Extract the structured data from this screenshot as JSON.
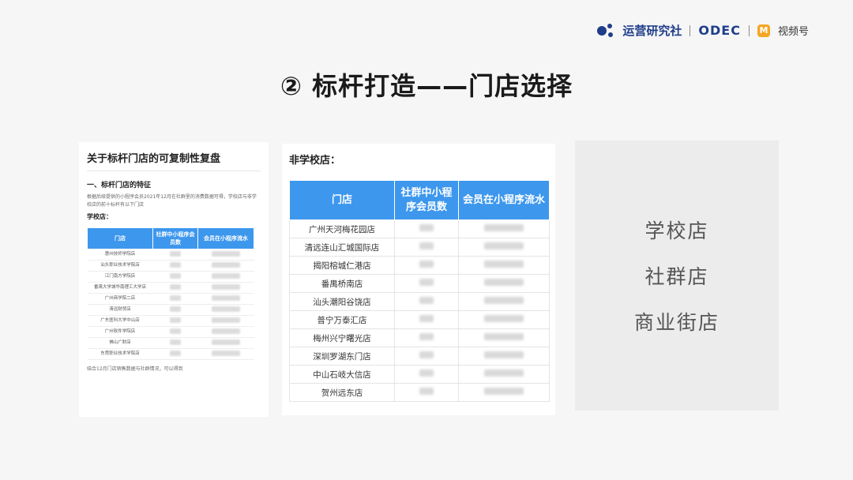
{
  "brand": {
    "name": "运营研究社",
    "odec": "ODEC",
    "video_icon": "M",
    "video": "视频号"
  },
  "title": "② 标杆打造——门店选择",
  "doc": {
    "title": "关于标杆门店的可复制性复盘",
    "section": "一、标杆门店的特征",
    "paragraph": "根据后续提供的小程序会员2021年12月在社群里的消费数据可得，学校店与非学校店的前十标杆有以下门店",
    "subtitle": "学校店：",
    "headers": [
      "门店",
      "社群中小程序会员数",
      "会员在小程序流水"
    ],
    "rows": [
      "惠州技师学院店",
      "汕头职业技术学院店",
      "江门南方学院店",
      "番禺大学城华南理工大学店",
      "广州商学院二店",
      "清远财贸店",
      "广东医科大学中山店",
      "广州软件学院店",
      "佛山广财店",
      "东莞职业技术学院店"
    ],
    "note": "结合12月门店销售数据与社群情况，可以得到"
  },
  "mid": {
    "title": "非学校店：",
    "headers": [
      "门店",
      "社群中小程序会员数",
      "会员在小程序流水"
    ],
    "rows": [
      "广州天河梅花园店",
      "清远连山汇城国际店",
      "揭阳榕城仁港店",
      "番禺桥南店",
      "汕头潮阳谷饶店",
      "普宁万泰汇店",
      "梅州兴宁曙光店",
      "深圳罗湖东门店",
      "中山石岐大信店",
      "贺州远东店"
    ]
  },
  "right": {
    "items": [
      "学校店",
      "社群店",
      "商业街店"
    ]
  },
  "colors": {
    "table_header": "#3d97ed",
    "brand": "#1f3e8a"
  }
}
